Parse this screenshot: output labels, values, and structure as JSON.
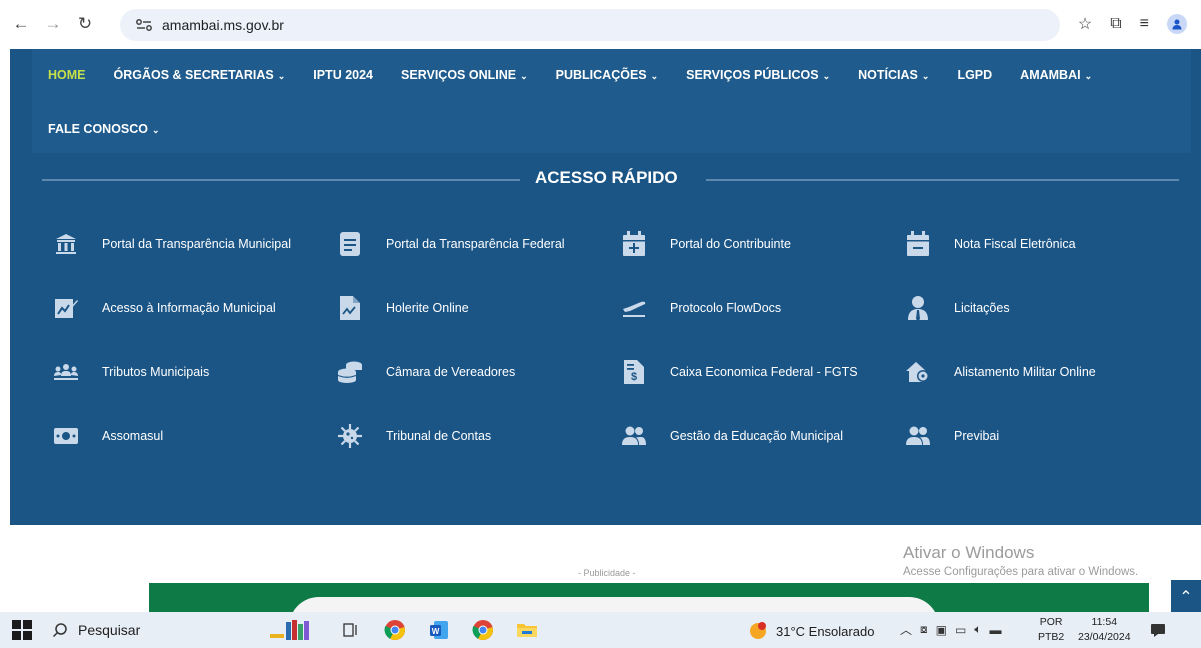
{
  "browser": {
    "url": "amambai.ms.gov.br"
  },
  "menu": {
    "row1": [
      {
        "label": "HOME",
        "dropdown": false,
        "active": true
      },
      {
        "label": "ÓRGÃOS & SECRETARIAS",
        "dropdown": true
      },
      {
        "label": "IPTU 2024",
        "dropdown": false
      },
      {
        "label": "SERVIÇOS ONLINE",
        "dropdown": true
      },
      {
        "label": "PUBLICAÇÕES",
        "dropdown": true
      },
      {
        "label": "SERVIÇOS PÚBLICOS",
        "dropdown": true
      },
      {
        "label": "NOTÍCIAS",
        "dropdown": true
      },
      {
        "label": "LGPD",
        "dropdown": false
      },
      {
        "label": "AMAMBAI",
        "dropdown": true
      }
    ],
    "row2": [
      {
        "label": "FALE CONOSCO",
        "dropdown": true
      }
    ],
    "chevron": "⌄"
  },
  "quick_access": {
    "title": "ACESSO RÁPIDO",
    "items": [
      {
        "label": "Portal da Transparência Municipal",
        "icon": "bank-icon"
      },
      {
        "label": "Portal da Transparência Federal",
        "icon": "document-icon"
      },
      {
        "label": "Portal do Contribuinte",
        "icon": "calendar-plus-icon"
      },
      {
        "label": "Nota Fiscal Eletrônica",
        "icon": "calendar-minus-icon"
      },
      {
        "label": "Acesso à Informação Municipal",
        "icon": "chart-edit-icon"
      },
      {
        "label": "Holerite Online",
        "icon": "file-chart-icon"
      },
      {
        "label": "Protocolo FlowDocs",
        "icon": "plane-takeoff-icon"
      },
      {
        "label": "Licitações",
        "icon": "user-tie-icon"
      },
      {
        "label": "Tributos Municipais",
        "icon": "users-icon"
      },
      {
        "label": "Câmara de Vereadores",
        "icon": "coins-icon"
      },
      {
        "label": "Caixa Economica Federal - FGTS",
        "icon": "file-dollar-icon"
      },
      {
        "label": "Alistamento Militar Online",
        "icon": "home-settings-icon"
      },
      {
        "label": "Assomasul",
        "icon": "money-bill-icon"
      },
      {
        "label": "Tribunal de Contas",
        "icon": "virus-icon"
      },
      {
        "label": "Gestão da Educação Municipal",
        "icon": "user-group-icon"
      },
      {
        "label": "Previbai",
        "icon": "user-group-icon"
      }
    ]
  },
  "ad": {
    "label": "- Publicidade -"
  },
  "windows_activation": {
    "line1": "Ativar o Windows",
    "line2": "Acesse Configurações para ativar o Windows."
  },
  "taskbar": {
    "search_label": "Pesquisar",
    "weather": "31°C  Ensolarado",
    "lang1": "POR",
    "lang2": "PTB2",
    "time": "11:54",
    "date": "23/04/2024"
  },
  "colors": {
    "site_bg": "#1b5586",
    "menu_bg": "#1f5b8c",
    "active_menu": "#c6e04a",
    "icon": "#c9d9ea"
  }
}
